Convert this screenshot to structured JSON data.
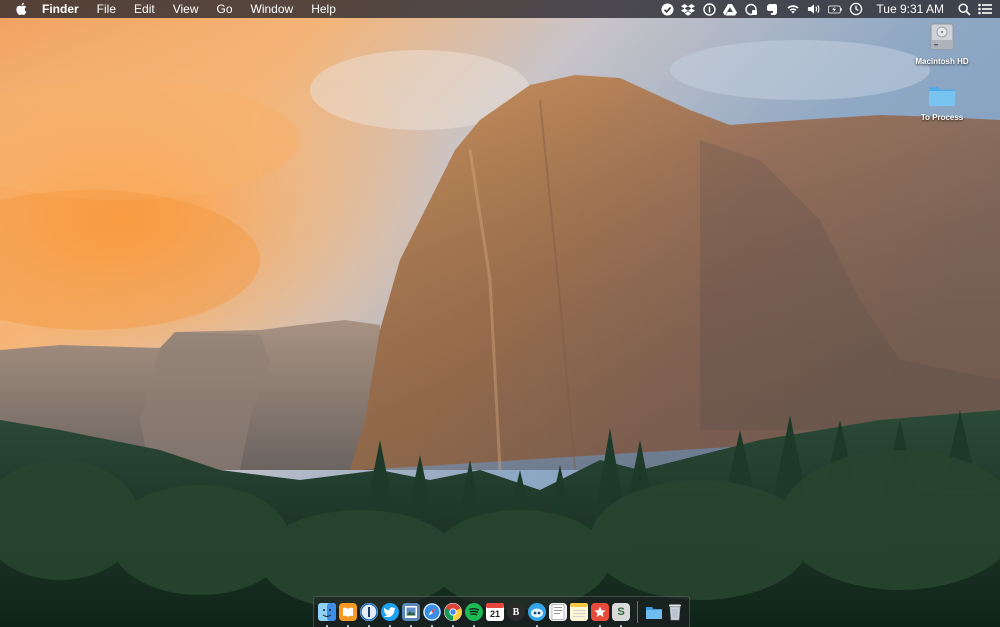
{
  "menubar": {
    "app_name": "Finder",
    "menus": [
      "File",
      "Edit",
      "View",
      "Go",
      "Window",
      "Help"
    ],
    "clock": "Tue 9:31 AM",
    "tray_icons": [
      "checkmark-circle-icon",
      "dropbox-icon",
      "onepassword-icon",
      "google-drive-icon",
      "time-machine-lock-icon",
      "evernote-icon",
      "wifi-icon",
      "volume-icon",
      "battery-charging-icon",
      "time-machine-icon",
      "spotlight-search-icon",
      "notification-center-icon"
    ]
  },
  "desktop": {
    "icons": [
      {
        "label": "Macintosh HD",
        "icon": "hard-drive-icon"
      },
      {
        "label": "To Process",
        "icon": "folder-icon"
      }
    ]
  },
  "dock": {
    "apps": [
      {
        "name": "finder-icon",
        "color": "#3d8ee8",
        "running": true
      },
      {
        "name": "ibooks-icon",
        "color": "#f59a24",
        "running": true
      },
      {
        "name": "onepassword-icon",
        "color": "#e8eef5",
        "running": true
      },
      {
        "name": "twitter-icon",
        "color": "#1da1f2",
        "running": true
      },
      {
        "name": "preview-icon",
        "color": "#5a86b8",
        "running": true
      },
      {
        "name": "safari-icon",
        "color": "#2e7fd8",
        "running": true
      },
      {
        "name": "chrome-icon",
        "color": "#e8453c",
        "running": true
      },
      {
        "name": "spotify-icon",
        "color": "#1db954",
        "running": true
      },
      {
        "name": "calendar-icon",
        "color": "#ffffff",
        "running": false,
        "text": "21"
      },
      {
        "name": "bear-icon",
        "color": "#2a2a2a",
        "running": false,
        "text": "B"
      },
      {
        "name": "tweetbot-icon",
        "color": "#33a4e8",
        "running": true
      },
      {
        "name": "textedit-icon",
        "color": "#f2f2f2",
        "running": false
      },
      {
        "name": "notes-icon",
        "color": "#f9e07a",
        "running": false
      },
      {
        "name": "wunderlist-icon",
        "color": "#e64b3b",
        "running": true
      },
      {
        "name": "scrivener-icon",
        "color": "#d9d9d9",
        "running": true,
        "text": "S"
      }
    ],
    "trailing": [
      {
        "name": "downloads-folder-icon",
        "color": "#5ab5ea"
      },
      {
        "name": "trash-icon",
        "color": "#c9d1da"
      }
    ]
  }
}
